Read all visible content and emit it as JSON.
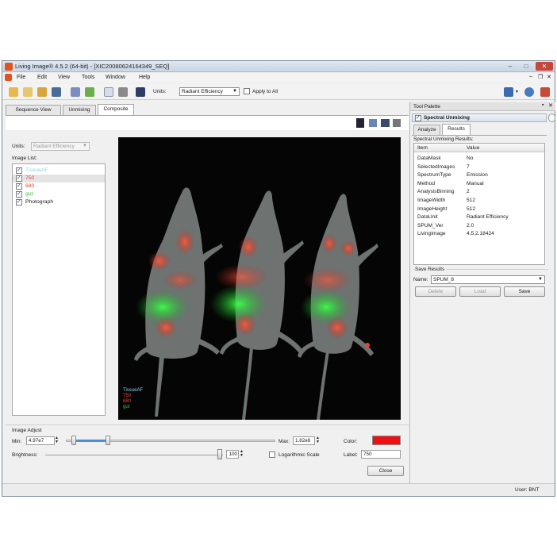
{
  "window": {
    "title": "Living Image® 4.5.2 (64-bit) - [XIC20080624164349_SEQ]",
    "minimize": "–",
    "maximize": "□",
    "close": "✕",
    "inner_minimize": "–",
    "inner_restore": "❐",
    "inner_close": "✕"
  },
  "menu": [
    "File",
    "Edit",
    "View",
    "Tools",
    "Window",
    "Help"
  ],
  "toolbar": {
    "units_label": "Units:",
    "units_value": "Radiant Efficiency",
    "apply_all_label": "Apply to All"
  },
  "tabs": [
    {
      "label": "Sequence View",
      "active": false
    },
    {
      "label": "Unmixing",
      "active": false
    },
    {
      "label": "Composite",
      "active": true
    }
  ],
  "left": {
    "units_label": "Units:",
    "units_value": "Radiant Efficiency",
    "image_list_label": "Image List:",
    "image_list": [
      {
        "label": "TissueAF",
        "color": "#7fd8ef",
        "checked": true
      },
      {
        "label": "750",
        "color": "#e8443a",
        "checked": true
      },
      {
        "label": "680",
        "color": "#e8443a",
        "checked": true
      },
      {
        "label": "gut",
        "color": "#35c33a",
        "checked": true
      },
      {
        "label": "Photograph",
        "color": "#1a1a1a",
        "checked": true
      }
    ]
  },
  "image_legend": [
    {
      "label": "TissueAF",
      "color": "#7fd8ef"
    },
    {
      "label": "750",
      "color": "#e8443a"
    },
    {
      "label": "680",
      "color": "#e8443a"
    },
    {
      "label": "gut",
      "color": "#35c33a"
    }
  ],
  "image_adjust": {
    "title": "Image Adjust",
    "min_label": "Min:",
    "min_value": "4.97e7",
    "max_label": "Max:",
    "max_value": "1.82e8",
    "brightness_label": "Brightness:",
    "brightness_value": "100",
    "log_scale_label": "Logarithmic Scale",
    "color_label": "Color:",
    "color_value": "#ee1111",
    "label_label": "Label:",
    "label_value": "750",
    "close_label": "Close"
  },
  "tool_palette": {
    "title": "Tool Palette",
    "section_title": "Spectral Unmixing",
    "tabs": [
      {
        "label": "Analyze",
        "active": false
      },
      {
        "label": "Results",
        "active": true
      }
    ],
    "results_title": "Spectral Unmixing Results:",
    "table_headers": [
      "Item",
      "Value"
    ],
    "rows": [
      [
        "DataMask",
        "No"
      ],
      [
        "SelectedImages",
        "7"
      ],
      [
        "SpectrumType",
        "Emission"
      ],
      [
        "Method",
        "Manual"
      ],
      [
        "AnalysisBinning",
        "2"
      ],
      [
        "ImageWidth",
        "512"
      ],
      [
        "ImageHeight",
        "512"
      ],
      [
        "DataUnit",
        "Radiant Efficiency"
      ],
      [
        "SPUM_Ver",
        "2.0"
      ],
      [
        "LivingImage",
        "4.5.2.18424"
      ]
    ],
    "save_results_title": "Save Results",
    "name_label": "Name:",
    "name_value": "SPUM_8",
    "delete_label": "Delete",
    "load_label": "Load",
    "save_label": "Save"
  },
  "status": {
    "user": "User: BNT"
  },
  "icons": {
    "app": "living-image-icon",
    "toolbar": [
      "open-folder-icon",
      "open-sequence-icon",
      "browse-icon",
      "save-icon",
      "copy-icon",
      "tag-icon",
      "page-icon",
      "print-icon",
      "help-pointer-icon"
    ],
    "right": [
      "camera-icon",
      "user-icon",
      "exit-icon"
    ],
    "composite_toolbar": [
      "image-thumb-icon",
      "copy-image-icon",
      "export-icon",
      "print-icon"
    ]
  }
}
